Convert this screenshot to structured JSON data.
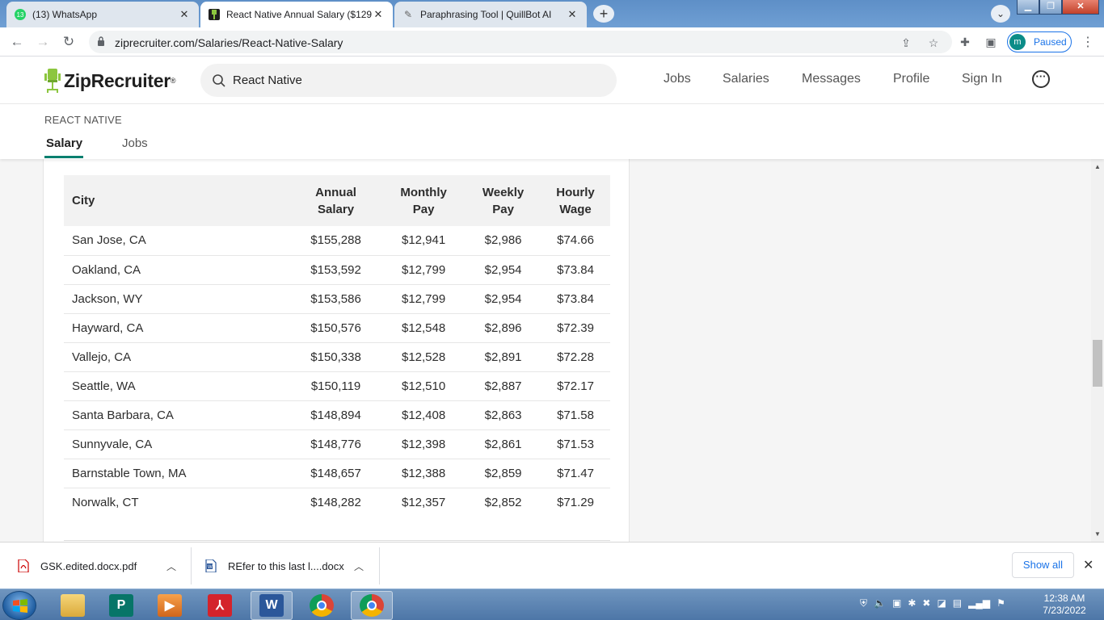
{
  "browser": {
    "tabs": [
      {
        "title": "(13) WhatsApp",
        "badge": "13"
      },
      {
        "title": "React Native Annual Salary ($129"
      },
      {
        "title": "Paraphrasing Tool | QuillBot AI"
      }
    ],
    "url": "ziprecruiter.com/Salaries/React-Native-Salary",
    "profile_initial": "m",
    "profile_status": "Paused"
  },
  "site": {
    "logo_text": "ZipRecruiter",
    "logo_reg": "®",
    "search_value": "React Native",
    "nav": [
      "Jobs",
      "Salaries",
      "Messages",
      "Profile",
      "Sign In"
    ],
    "more_label": "···"
  },
  "subheader": {
    "breadcrumb": "REACT NATIVE",
    "tabs": [
      "Salary",
      "Jobs"
    ],
    "active_tab": "Salary"
  },
  "table": {
    "headers": {
      "city": "City",
      "annual": [
        "Annual",
        "Salary"
      ],
      "monthly": [
        "Monthly",
        "Pay"
      ],
      "weekly": [
        "Weekly",
        "Pay"
      ],
      "hourly": [
        "Hourly",
        "Wage"
      ]
    },
    "rows": [
      {
        "city": "San Jose, CA",
        "annual": "$155,288",
        "monthly": "$12,941",
        "weekly": "$2,986",
        "hourly": "$74.66"
      },
      {
        "city": "Oakland, CA",
        "annual": "$153,592",
        "monthly": "$12,799",
        "weekly": "$2,954",
        "hourly": "$73.84"
      },
      {
        "city": "Jackson, WY",
        "annual": "$153,586",
        "monthly": "$12,799",
        "weekly": "$2,954",
        "hourly": "$73.84"
      },
      {
        "city": "Hayward, CA",
        "annual": "$150,576",
        "monthly": "$12,548",
        "weekly": "$2,896",
        "hourly": "$72.39"
      },
      {
        "city": "Vallejo, CA",
        "annual": "$150,338",
        "monthly": "$12,528",
        "weekly": "$2,891",
        "hourly": "$72.28"
      },
      {
        "city": "Seattle, WA",
        "annual": "$150,119",
        "monthly": "$12,510",
        "weekly": "$2,887",
        "hourly": "$72.17"
      },
      {
        "city": "Santa Barbara, CA",
        "annual": "$148,894",
        "monthly": "$12,408",
        "weekly": "$2,863",
        "hourly": "$71.58"
      },
      {
        "city": "Sunnyvale, CA",
        "annual": "$148,776",
        "monthly": "$12,398",
        "weekly": "$2,861",
        "hourly": "$71.53"
      },
      {
        "city": "Barnstable Town, MA",
        "annual": "$148,657",
        "monthly": "$12,388",
        "weekly": "$2,859",
        "hourly": "$71.47"
      },
      {
        "city": "Norwalk, CT",
        "annual": "$148,282",
        "monthly": "$12,357",
        "weekly": "$2,852",
        "hourly": "$71.29"
      }
    ]
  },
  "downloads": {
    "items": [
      {
        "name": "GSK.edited.docx.pdf",
        "icon": "pdf-file-icon"
      },
      {
        "name": "REfer to this last l....docx",
        "icon": "word-file-icon"
      }
    ],
    "show_all": "Show all"
  },
  "taskbar": {
    "apps": [
      "file-explorer",
      "publisher",
      "media-player",
      "acrobat",
      "word",
      "chrome",
      "chrome-profile"
    ],
    "time": "12:38 AM",
    "date": "7/23/2022"
  },
  "colors": {
    "brand_green": "#0a7f6f",
    "logo_green": "#8cc63f",
    "link_blue": "#1a73e8"
  }
}
